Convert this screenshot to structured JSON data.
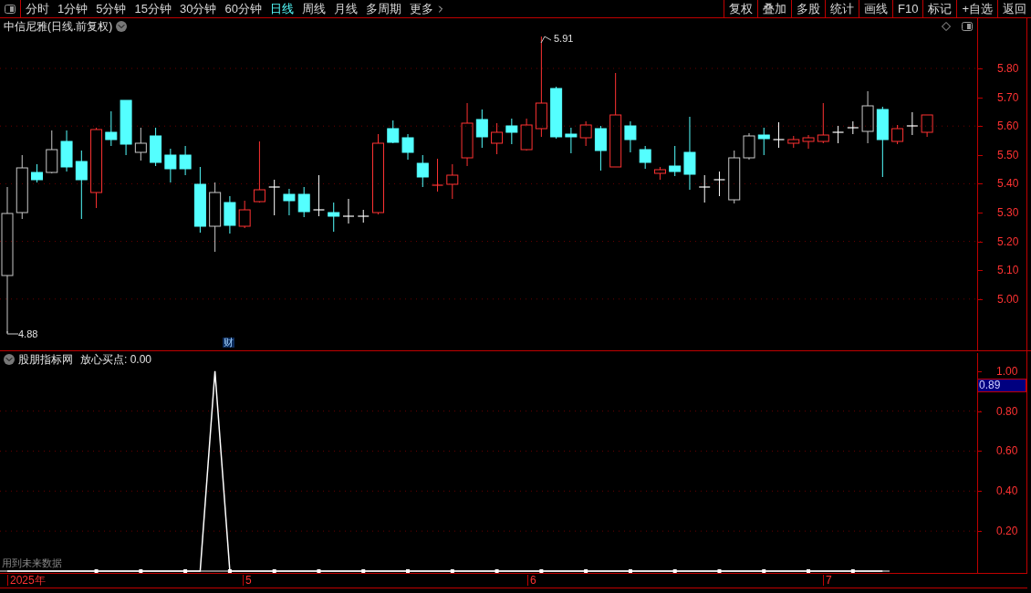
{
  "toolbar": {
    "periods": [
      {
        "label": "分时",
        "selected": false
      },
      {
        "label": "1分钟",
        "selected": false
      },
      {
        "label": "5分钟",
        "selected": false
      },
      {
        "label": "15分钟",
        "selected": false
      },
      {
        "label": "30分钟",
        "selected": false
      },
      {
        "label": "60分钟",
        "selected": false
      },
      {
        "label": "日线",
        "selected": true
      },
      {
        "label": "周线",
        "selected": false
      },
      {
        "label": "月线",
        "selected": false
      },
      {
        "label": "多周期",
        "selected": false
      }
    ],
    "more": "更多",
    "buttons": [
      "复权",
      "叠加",
      "多股",
      "统计",
      "画线",
      "F10",
      "标记",
      "+自选",
      "返回"
    ]
  },
  "main_pane": {
    "title": "中信尼雅(日线.前复权)",
    "high_label": "5.91",
    "low_label": "4.88",
    "event_badge": "财",
    "price_axis": [
      "5.80",
      "5.70",
      "5.60",
      "5.50",
      "5.40",
      "5.30",
      "5.20",
      "5.10",
      "5.00"
    ]
  },
  "indicator_pane": {
    "source": "股朋指标网",
    "reading": ": 0.00",
    "cursor_value": "0.89",
    "warning": "用到未来数据",
    "chart_data": {
      "type": "line",
      "ylim": [
        0,
        1.09
      ],
      "grid": true,
      "yticks": [
        {
          "value": 0.2,
          "label": "0.20"
        },
        {
          "value": 0.4,
          "label": "0.40"
        },
        {
          "value": 0.6,
          "label": "0.60"
        },
        {
          "value": 0.8,
          "label": "0.80"
        },
        {
          "value": 1,
          "label": "1.00"
        }
      ],
      "series": [
        {
          "name": "放心买点",
          "color": "#ffffff",
          "values": [
            0,
            0,
            0,
            0,
            0,
            0,
            0,
            0,
            0,
            0,
            0,
            0,
            0,
            0,
            1,
            0,
            0,
            0,
            0,
            0,
            0,
            0,
            0,
            0,
            0,
            0,
            0,
            0,
            0,
            0,
            0,
            0,
            0,
            0,
            0,
            0,
            0,
            0,
            0,
            0,
            0,
            0,
            0,
            0,
            0,
            0,
            0,
            0,
            0,
            0,
            0,
            0,
            0,
            0,
            0,
            0,
            0,
            0,
            0,
            0
          ]
        }
      ]
    }
  },
  "date_axis": [
    "2025年",
    "5",
    "6",
    "7"
  ]
}
